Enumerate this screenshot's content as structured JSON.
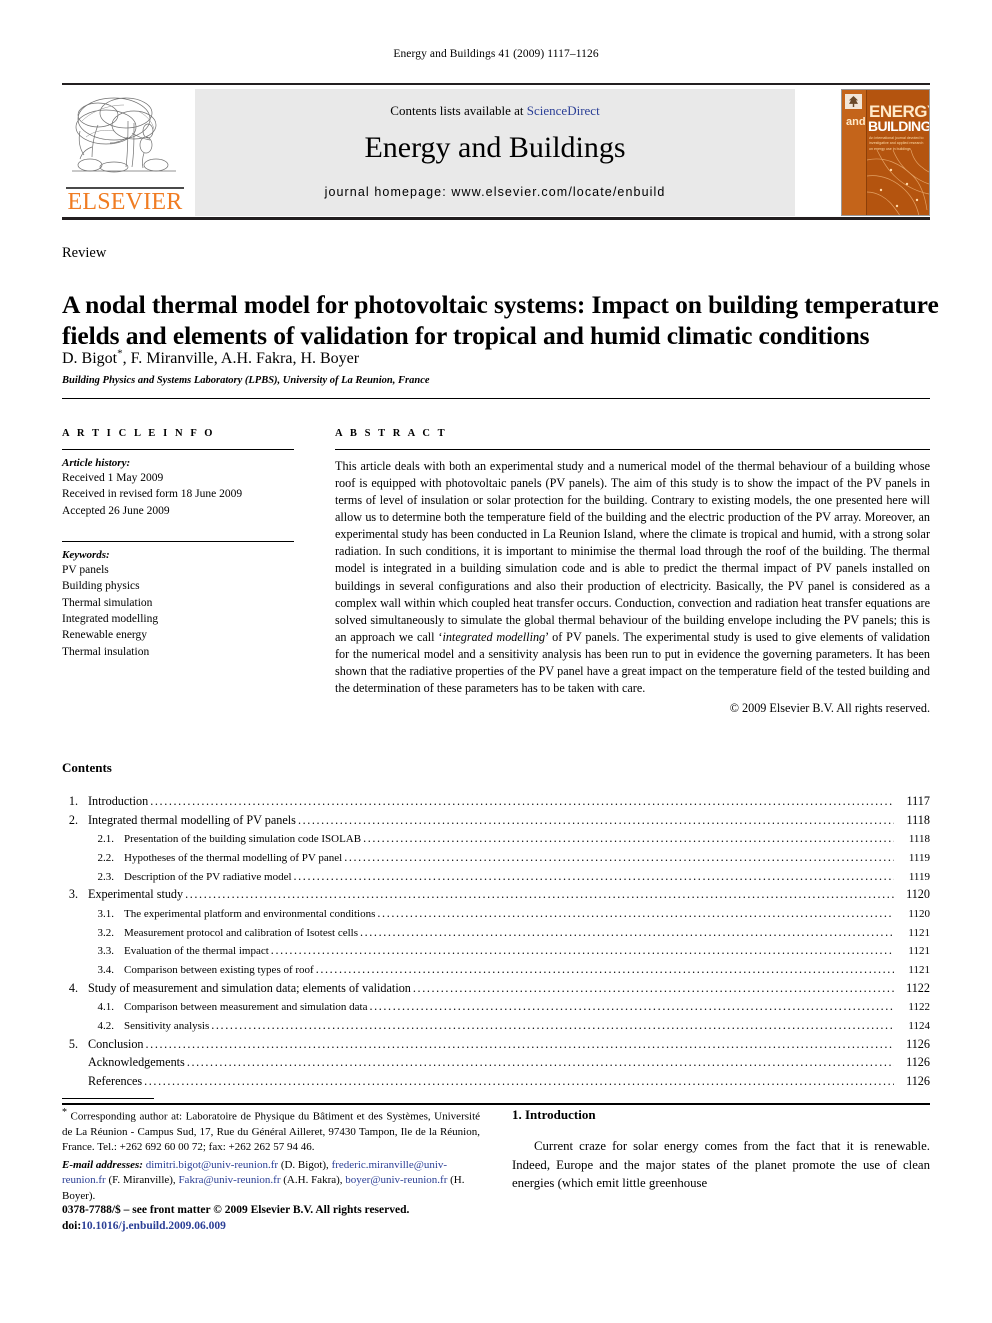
{
  "running_head": "Energy and Buildings 41 (2009) 1117–1126",
  "masthead": {
    "contents_prefix": "Contents lists available at ",
    "sciencedirect": "ScienceDirect",
    "journal_title": "Energy and Buildings",
    "homepage": "journal homepage: www.elsevier.com/locate/enbuild",
    "publisher_wordmark": "ELSEVIER",
    "cover": {
      "word_and": "and",
      "word_energy": "ENERGY",
      "word_buildings": "BUILDINGS",
      "subtitle": "An international journal devoted to investigative and applied research on energy use in buildings"
    },
    "accent_orange": "#f07c22",
    "link_blue": "#2b3f96",
    "band_gray": "#e9e9e9"
  },
  "article": {
    "type": "Review",
    "title": "A nodal thermal model for photovoltaic systems: Impact on building temperature fields and elements of validation for tropical and humid climatic conditions",
    "authors": "D. Bigot , F. Miranville, A.H. Fakra, H. Boyer",
    "corresponding_marker": "*",
    "affiliation": "Building Physics and Systems Laboratory (LPBS), University of La Reunion, France"
  },
  "article_info": {
    "heading": "A R T I C L E  I N F O",
    "history_label": "Article history:",
    "history": [
      "Received 1 May 2009",
      "Received in revised form 18 June 2009",
      "Accepted 26 June 2009"
    ],
    "keywords_label": "Keywords:",
    "keywords": [
      "PV panels",
      "Building physics",
      "Thermal simulation",
      "Integrated modelling",
      "Renewable energy",
      "Thermal insulation"
    ]
  },
  "abstract": {
    "heading": "A B S T R A C T",
    "part1": "This article deals with both an experimental study and a numerical model of the thermal behaviour of a building whose roof is equipped with photovoltaic panels (PV panels). The aim of this study is to show the impact of the PV panels in terms of level of insulation or solar protection for the building. Contrary to existing models, the one presented here will allow us to determine both the temperature field of the building and the electric production of the PV array. Moreover, an experimental study has been conducted in La Reunion Island, where the climate is tropical and humid, with a strong solar radiation. In such conditions, it is important to minimise the thermal load through the roof of the building. The thermal model is integrated in a building simulation code and is able to predict the thermal impact of PV panels installed on buildings in several configurations and also their production of electricity. Basically, the PV panel is considered as a complex wall within which coupled heat transfer occurs. Conduction, convection and radiation heat transfer equations are solved simultaneously to simulate the global thermal behaviour of the building envelope including the PV panels; this is an approach we call ‘",
    "italic_phrase": "integrated modelling",
    "part2": "’ of PV panels. The experimental study is used to give elements of validation for the numerical model and a sensitivity analysis has been run to put in evidence the governing parameters. It has been shown that the radiative properties of the PV panel have a great impact on the temperature field of the tested building and the determination of these parameters has to be taken with care.",
    "copyright": "© 2009 Elsevier B.V. All rights reserved."
  },
  "contents": {
    "title": "Contents",
    "entries": [
      {
        "num": "1.",
        "label": "Introduction",
        "page": "1117",
        "level": 1
      },
      {
        "num": "2.",
        "label": "Integrated thermal modelling of PV panels",
        "page": "1118",
        "level": 1
      },
      {
        "num": "2.1.",
        "label": "Presentation of the building simulation code ISOLAB",
        "page": "1118",
        "level": 2
      },
      {
        "num": "2.2.",
        "label": "Hypotheses of the thermal modelling of PV panel",
        "page": "1119",
        "level": 2
      },
      {
        "num": "2.3.",
        "label": "Description of the PV radiative model",
        "page": "1119",
        "level": 2
      },
      {
        "num": "3.",
        "label": "Experimental study",
        "page": "1120",
        "level": 1
      },
      {
        "num": "3.1.",
        "label": "The experimental platform and environmental conditions",
        "page": "1120",
        "level": 2
      },
      {
        "num": "3.2.",
        "label": "Measurement protocol and calibration of Isotest cells",
        "page": "1121",
        "level": 2
      },
      {
        "num": "3.3.",
        "label": "Evaluation of the thermal impact",
        "page": "1121",
        "level": 2
      },
      {
        "num": "3.4.",
        "label": "Comparison between existing types of roof",
        "page": "1121",
        "level": 2
      },
      {
        "num": "4.",
        "label": "Study of measurement and simulation data; elements of validation",
        "page": "1122",
        "level": 1
      },
      {
        "num": "4.1.",
        "label": "Comparison between measurement and simulation data",
        "page": "1122",
        "level": 2
      },
      {
        "num": "4.2.",
        "label": "Sensitivity analysis",
        "page": "1124",
        "level": 2
      },
      {
        "num": "5.",
        "label": "Conclusion",
        "page": "1126",
        "level": 1
      },
      {
        "num": "",
        "label": "Acknowledgements",
        "page": "1126",
        "level": 1
      },
      {
        "num": "",
        "label": "References",
        "page": "1126",
        "level": 1
      }
    ]
  },
  "footnote": {
    "corresponding": "Corresponding author at: Laboratoire de Physique du Bâtiment et des Systèmes, Université de La Réunion - Campus Sud, 17, Rue du Général Ailleret, 97430 Tampon, Ile de la Réunion, France. Tel.: +262 692 60 00 72; fax: +262 262 57 94 46.",
    "email_label": "E-mail addresses:",
    "emails": [
      {
        "address": "dimitri.bigot@univ-reunion.fr",
        "person": "(D. Bigot),"
      },
      {
        "address": "frederic.miranville@univ-reunion.fr",
        "person": "(F. Miranville),"
      },
      {
        "address": "Fakra@univ-reunion.fr",
        "person": "(A.H. Fakra),"
      },
      {
        "address": "boyer@univ-reunion.fr",
        "person": "(H. Boyer)."
      }
    ]
  },
  "issn": {
    "line1": "0378-7788/$ – see front matter © 2009 Elsevier B.V. All rights reserved.",
    "doi_label": "doi:",
    "doi_value": "10.1016/j.enbuild.2009.06.009"
  },
  "introduction": {
    "heading": "1. Introduction",
    "paragraph": "Current craze for solar energy comes from the fact that it is renewable. Indeed, Europe and the major states of the planet promote the use of clean energies (which emit little greenhouse"
  }
}
